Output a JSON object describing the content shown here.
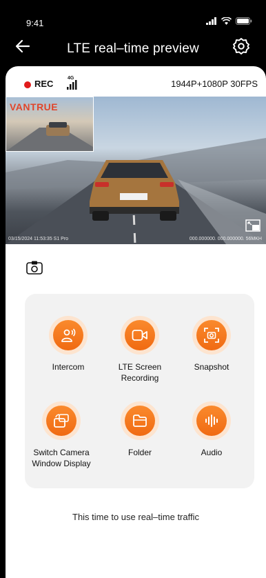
{
  "status": {
    "time": "9:41"
  },
  "nav": {
    "title": "LTE real–time preview",
    "back_icon": "back-arrow-icon",
    "settings_icon": "gear-icon"
  },
  "recording": {
    "rec_label": "REC",
    "network": "4G",
    "resolution": "1944P+1080P 30FPS",
    "rec_color": "#e11b1b"
  },
  "video": {
    "pip_brand": "VANTRUE",
    "timestamp": "03/15/2024  11:53:35  S1 Pro",
    "gps": "000.000000.  000.000000.  56MKH"
  },
  "functions": [
    {
      "label": "Intercom",
      "icon": "intercom-icon"
    },
    {
      "label": "LTE Screen Recording",
      "icon": "screen-record-icon"
    },
    {
      "label": "Snapshot",
      "icon": "snapshot-icon"
    },
    {
      "label": "Switch Camera Window Display",
      "icon": "switch-camera-icon"
    },
    {
      "label": "Folder",
      "icon": "folder-icon"
    },
    {
      "label": "Audio",
      "icon": "audio-icon"
    }
  ],
  "accent_color": "#f07a1f",
  "footer": {
    "note": "This time to use real–time traffic"
  }
}
